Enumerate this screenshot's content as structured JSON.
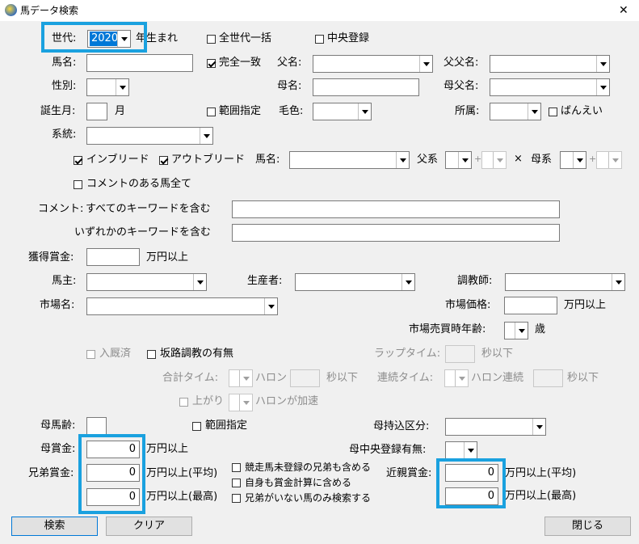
{
  "window": {
    "title": "馬データ検索",
    "close_glyph": "✕"
  },
  "generation": {
    "label": "世代:",
    "value": "2020",
    "suffix": "年生まれ",
    "all_generations": "全世代一括",
    "central": "中央登録"
  },
  "row2": {
    "horse_name": "馬名:",
    "exact_match": "完全一致",
    "sire": "父名:",
    "sire_sire": "父父名:"
  },
  "row3": {
    "sex": "性別:",
    "dam": "母名:",
    "dam_sire": "母父名:"
  },
  "row4": {
    "birth_month": "誕生月:",
    "month_unit": "月",
    "range": "範囲指定",
    "coat": "毛色:",
    "affiliation": "所属:",
    "banei": "ばんえい"
  },
  "row5": {
    "lineage": "系統:"
  },
  "inbreed": {
    "inbreed": "インブリード",
    "outbreed": "アウトブリード",
    "horse_name": "馬名:",
    "paternal": "父系",
    "maternal": "母系",
    "plus": "+",
    "times": "×"
  },
  "comment": {
    "has_comment": "コメントのある馬全て",
    "label": "コメント:",
    "all_keywords": "すべてのキーワードを含む",
    "any_keywords": "いずれかのキーワードを含む"
  },
  "prize": {
    "label": "獲得賞金:",
    "unit": "万円以上"
  },
  "people": {
    "owner": "馬主:",
    "breeder": "生産者:",
    "trainer": "調教師:"
  },
  "market": {
    "name": "市場名:",
    "price": "市場価格:",
    "price_unit": "万円以上",
    "age_label": "市場売買時年齢:",
    "age_unit": "歳"
  },
  "training": {
    "retired": "入厩済",
    "slope": "坂路調教の有無",
    "lap_time": "ラップタイム:",
    "sec_below": "秒以下",
    "total_time": "合計タイム:",
    "furlong": "ハロン",
    "sec_below2": "秒以下",
    "consec_time": "連続タイム:",
    "furlong_consec": "ハロン連続",
    "sec_below3": "秒以下",
    "rising": "上がり",
    "accelerating": "ハロンが加速"
  },
  "dam": {
    "age": "母馬齢:",
    "range": "範囲指定",
    "import_label": "母持込区分:",
    "prize_label": "母賞金:",
    "prize_value": "0",
    "prize_unit": "万円以上",
    "central_label": "母中央登録有無:"
  },
  "sibling": {
    "label": "兄弟賞金:",
    "avg_value": "0",
    "avg_unit": "万円以上(平均)",
    "max_value": "0",
    "max_unit": "万円以上(最高)",
    "opt1": "競走馬未登録の兄弟も含める",
    "opt2": "自身も賞金計算に含める",
    "opt3": "兄弟がいない馬のみ検索する"
  },
  "relatives": {
    "label": "近親賞金:",
    "avg_value": "0",
    "avg_unit": "万円以上(平均)",
    "max_value": "0",
    "max_unit": "万円以上(最高)"
  },
  "buttons": {
    "search": "検索",
    "clear": "クリア",
    "close": "閉じる"
  },
  "colors": {
    "highlight": "#1aa1df",
    "selection": "#0078d7",
    "background": "#f0f0f0"
  }
}
